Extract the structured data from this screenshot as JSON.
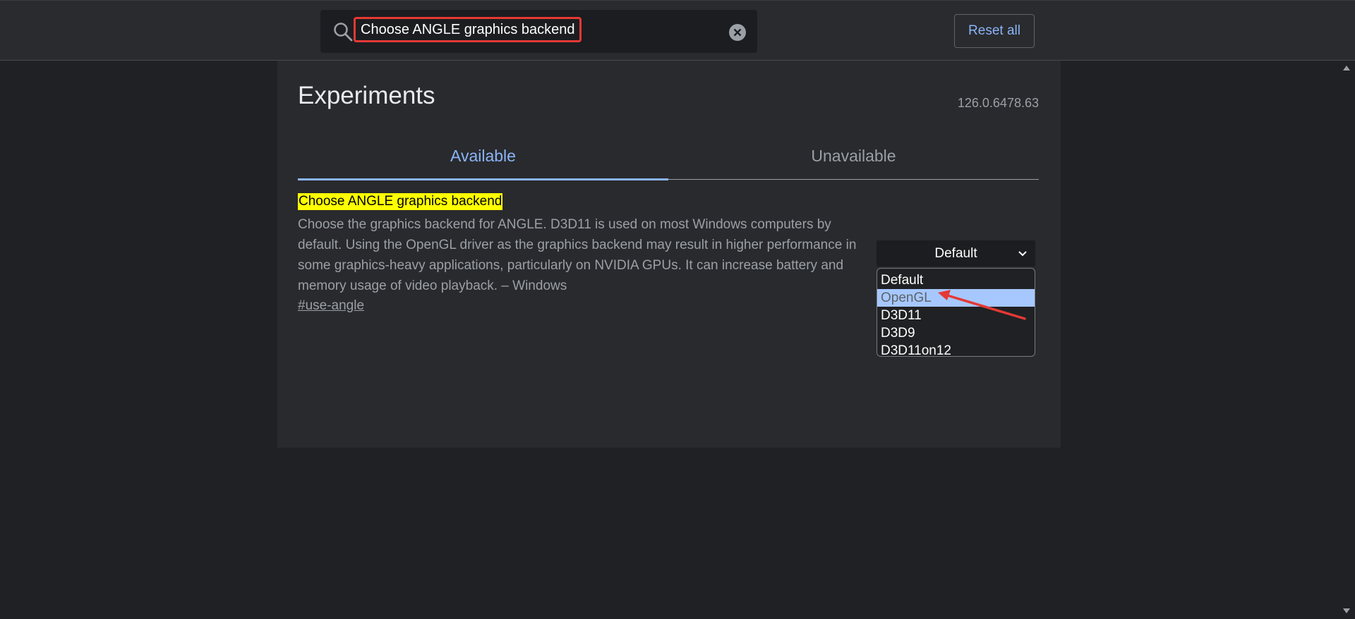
{
  "search": {
    "value": "Choose ANGLE graphics backend"
  },
  "toolbar": {
    "reset_label": "Reset all"
  },
  "page": {
    "title": "Experiments",
    "version": "126.0.6478.63"
  },
  "tabs": [
    {
      "label": "Available",
      "active": true
    },
    {
      "label": "Unavailable",
      "active": false
    }
  ],
  "flag": {
    "title": "Choose ANGLE graphics backend",
    "description": "Choose the graphics backend for ANGLE. D3D11 is used on most Windows computers by default. Using the OpenGL driver as the graphics backend may result in higher performance in some graphics-heavy applications, particularly on NVIDIA GPUs. It can increase battery and memory usage of video playback. – Windows",
    "link": "#use-angle",
    "select_value": "Default",
    "options": [
      "Default",
      "OpenGL",
      "D3D11",
      "D3D9",
      "D3D11on12"
    ],
    "highlighted_option": "OpenGL"
  },
  "colors": {
    "accent": "#8ab4f8",
    "highlight": "#ffff00",
    "annotation": "#e53935",
    "option_highlight": "#a6c8ff"
  },
  "icons": {
    "search": "search-icon",
    "clear": "close-icon",
    "chevron": "chevron-down-icon"
  }
}
